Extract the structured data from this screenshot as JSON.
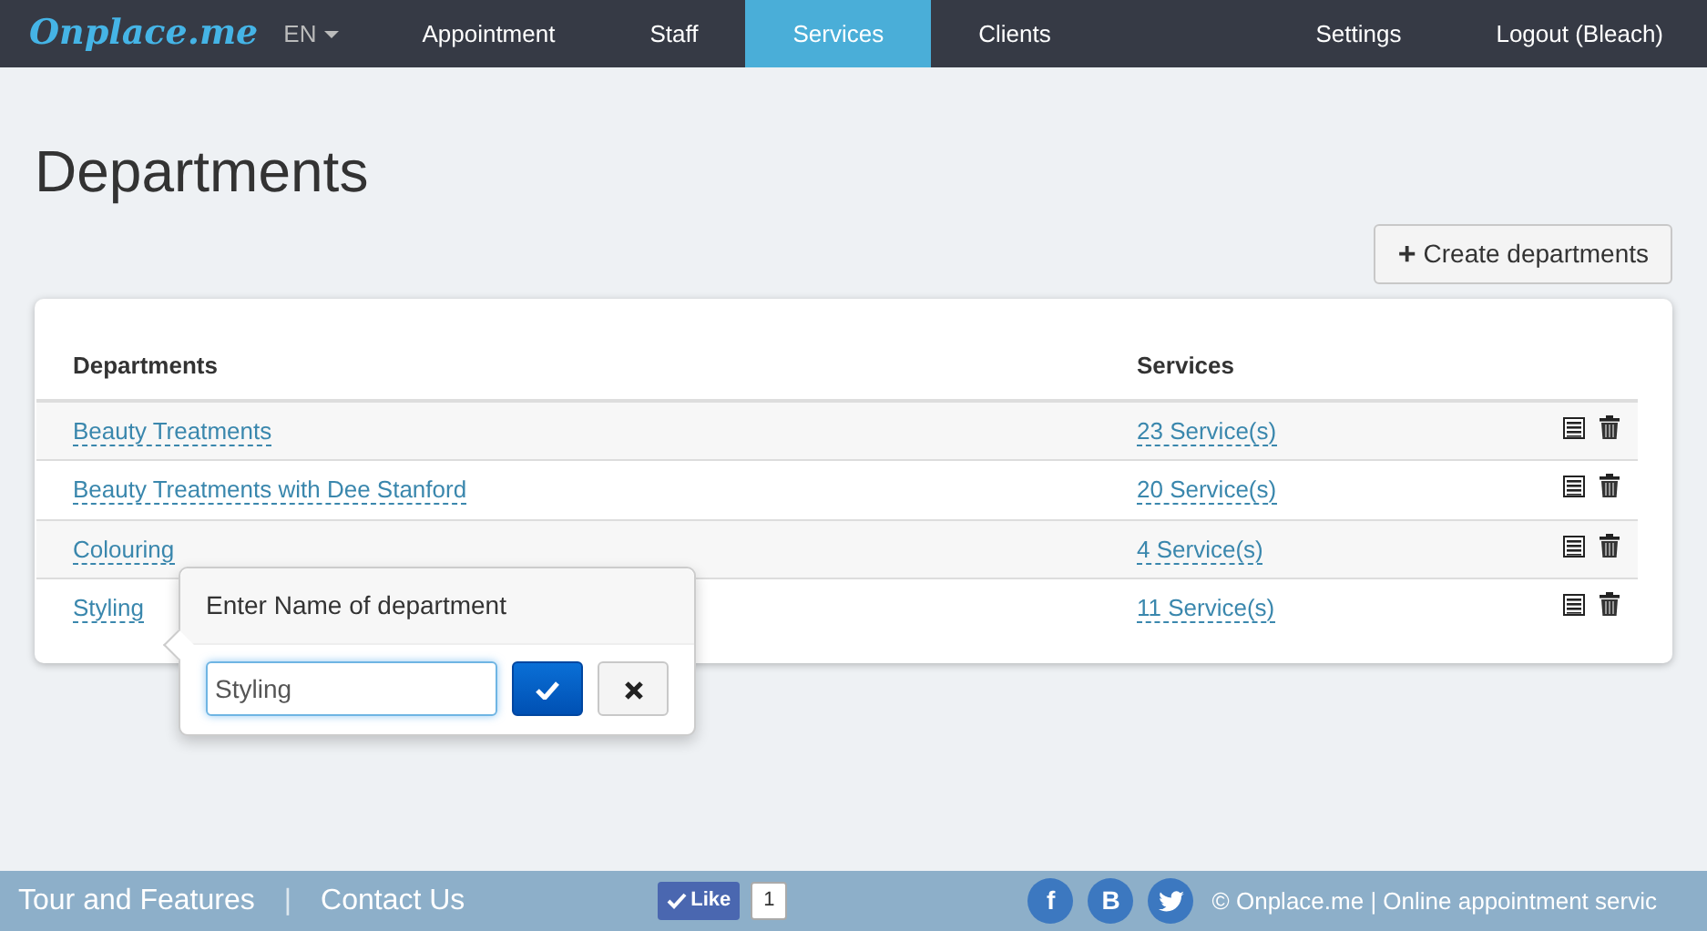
{
  "navbar": {
    "logo": "Onplace.me",
    "language": "EN",
    "items": [
      {
        "label": "Appointment",
        "selected": false
      },
      {
        "label": "Staff",
        "selected": false
      },
      {
        "label": "Services",
        "selected": true
      },
      {
        "label": "Clients",
        "selected": false
      }
    ],
    "right_items": [
      {
        "label": "Settings"
      },
      {
        "label": "Logout (Bleach)"
      }
    ]
  },
  "page_title": "Departments",
  "create_button": {
    "icon": "+",
    "label": "Create departments"
  },
  "table": {
    "columns": [
      "Departments",
      "Services"
    ],
    "rows": [
      {
        "department": "Beauty Treatments",
        "services": "23 Service(s)"
      },
      {
        "department": "Beauty Treatments with Dee Stanford",
        "services": "20 Service(s)"
      },
      {
        "department": "Colouring",
        "services": "4 Service(s)"
      },
      {
        "department": "Styling",
        "services": "11 Service(s)",
        "editing": true
      }
    ]
  },
  "edit_popover": {
    "title": "Enter Name of department",
    "value": "Styling"
  },
  "footer": {
    "links": [
      "Tour and Features",
      "Contact Us"
    ],
    "like": {
      "label": "Like",
      "count": "1"
    },
    "separator": "|",
    "social": [
      {
        "kind": "letter",
        "glyph": "f"
      },
      {
        "kind": "letter",
        "glyph": "B"
      },
      {
        "kind": "bird"
      }
    ],
    "copyright": "© Onplace.me | Online appointment servic"
  }
}
